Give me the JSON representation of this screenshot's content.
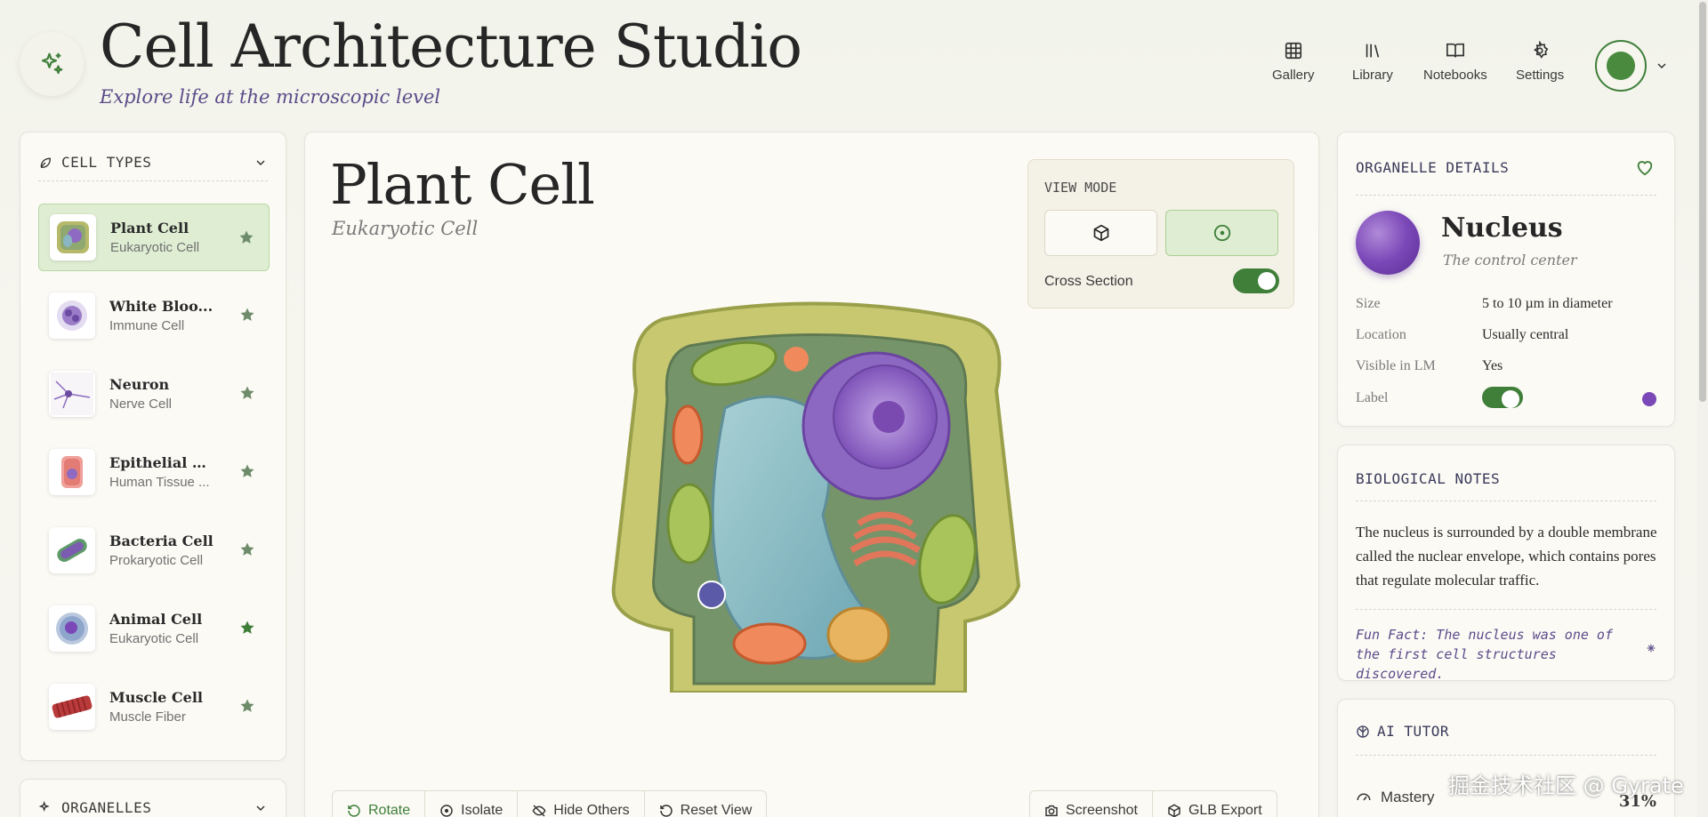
{
  "header": {
    "title": "Cell Architecture Studio",
    "subtitle": "Explore life at the microscopic level",
    "nav": [
      {
        "label": "Gallery",
        "icon": "grid-icon"
      },
      {
        "label": "Library",
        "icon": "library-icon"
      },
      {
        "label": "Notebooks",
        "icon": "book-icon"
      },
      {
        "label": "Settings",
        "icon": "gear-icon"
      }
    ]
  },
  "sidebar": {
    "cell_types_title": "CELL TYPES",
    "organelles_title": "ORGANELLES",
    "items": [
      {
        "name": "Plant Cell",
        "sub": "Eukaryotic Cell",
        "active": true,
        "favorite": false
      },
      {
        "name": "White Bloo...",
        "sub": "Immune Cell",
        "active": false,
        "favorite": false
      },
      {
        "name": "Neuron",
        "sub": "Nerve Cell",
        "active": false,
        "favorite": false
      },
      {
        "name": "Epithelial Cell",
        "sub": "Human Tissue ...",
        "active": false,
        "favorite": false
      },
      {
        "name": "Bacteria Cell",
        "sub": "Prokaryotic Cell",
        "active": false,
        "favorite": false
      },
      {
        "name": "Animal Cell",
        "sub": "Eukaryotic Cell",
        "active": false,
        "favorite": true
      },
      {
        "name": "Muscle Cell",
        "sub": "Muscle Fiber",
        "active": false,
        "favorite": false
      }
    ]
  },
  "main": {
    "title": "Plant Cell",
    "subtitle": "Eukaryotic Cell",
    "view_mode": {
      "title": "VIEW MODE",
      "cross_section_label": "Cross Section",
      "cross_section_on": true,
      "selected": "cross-section"
    },
    "toolbar_left": [
      "Rotate",
      "Isolate",
      "Hide Others",
      "Reset View"
    ],
    "toolbar_right": [
      "Screenshot",
      "GLB Export"
    ]
  },
  "details": {
    "title": "ORGANELLE DETAILS",
    "name": "Nucleus",
    "tagline": "The control center",
    "props": [
      {
        "key": "Size",
        "value": "5 to 10 µm in diameter"
      },
      {
        "key": "Location",
        "value": "Usually central"
      },
      {
        "key": "Visible in LM",
        "value": "Yes"
      },
      {
        "key": "Label",
        "value": ""
      }
    ],
    "label_on": true,
    "label_color": "#7b48b8"
  },
  "notes": {
    "title": "BIOLOGICAL NOTES",
    "text": "The nucleus is surrounded by a double membrane called the nuclear envelope, which contains pores that regulate molecular traffic.",
    "fun_fact": "Fun Fact: The nucleus was one of the first cell structures discovered."
  },
  "tutor": {
    "title": "AI TUTOR",
    "mastery_label": "Mastery",
    "mastery_value": "31%"
  },
  "watermark": "掘金技术社区 @ Gyrate",
  "colors": {
    "accent": "#3f7f3a",
    "purple": "#5b4b8a",
    "nucleus": "#7b48b8"
  }
}
